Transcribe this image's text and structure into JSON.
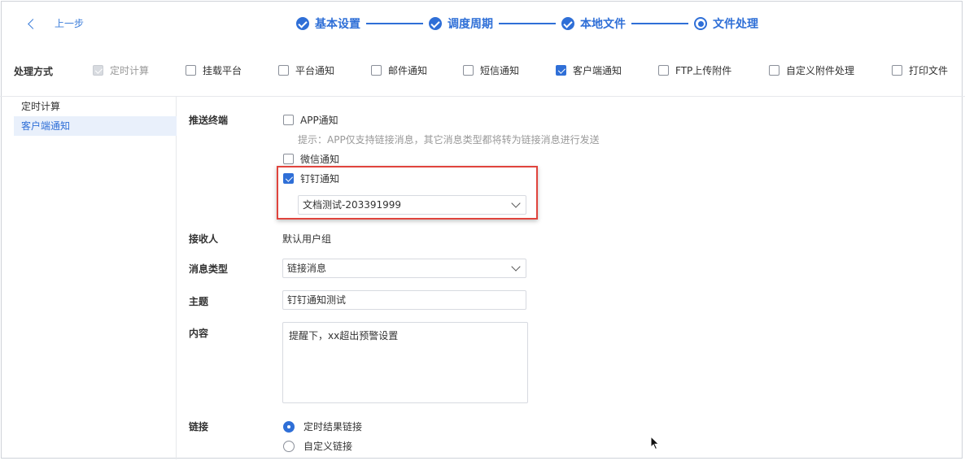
{
  "header": {
    "back_label": "上一步",
    "steps": [
      {
        "label": "基本设置",
        "state": "done"
      },
      {
        "label": "调度周期",
        "state": "done"
      },
      {
        "label": "本地文件",
        "state": "done"
      },
      {
        "label": "文件处理",
        "state": "current"
      }
    ]
  },
  "method": {
    "label": "处理方式",
    "options": [
      {
        "label": "定时计算",
        "checked": true,
        "disabled": true
      },
      {
        "label": "挂载平台",
        "checked": false
      },
      {
        "label": "平台通知",
        "checked": false
      },
      {
        "label": "邮件通知",
        "checked": false
      },
      {
        "label": "短信通知",
        "checked": false
      },
      {
        "label": "客户端通知",
        "checked": true
      },
      {
        "label": "FTP上传附件",
        "checked": false
      },
      {
        "label": "自定义附件处理",
        "checked": false
      },
      {
        "label": "打印文件",
        "checked": false
      }
    ]
  },
  "sidebar": {
    "items": [
      {
        "label": "定时计算",
        "active": false
      },
      {
        "label": "客户端通知",
        "active": true
      }
    ]
  },
  "form": {
    "push_terminal_label": "推送终端",
    "app_notice": {
      "label": "APP通知",
      "checked": false
    },
    "app_hint": "提示：APP仅支持链接消息，其它消息类型都将转为链接消息进行发送",
    "wechat_notice": {
      "label": "微信通知",
      "checked": false
    },
    "dingtalk_notice": {
      "label": "钉钉通知",
      "checked": true
    },
    "dingtalk_group": "文档测试-203391999",
    "receiver_label": "接收人",
    "receiver_value": "默认用户组",
    "msg_type_label": "消息类型",
    "msg_type_value": "链接消息",
    "subject_label": "主题",
    "subject_value": "钉钉通知测试",
    "content_label": "内容",
    "content_value": "提醒下，xx超出预警设置",
    "link_label": "链接",
    "link_options": [
      {
        "label": "定时结果链接",
        "selected": true
      },
      {
        "label": "自定义链接",
        "selected": false
      }
    ]
  },
  "colors": {
    "accent": "#2f6fd7",
    "highlight_border": "#e0443d"
  }
}
